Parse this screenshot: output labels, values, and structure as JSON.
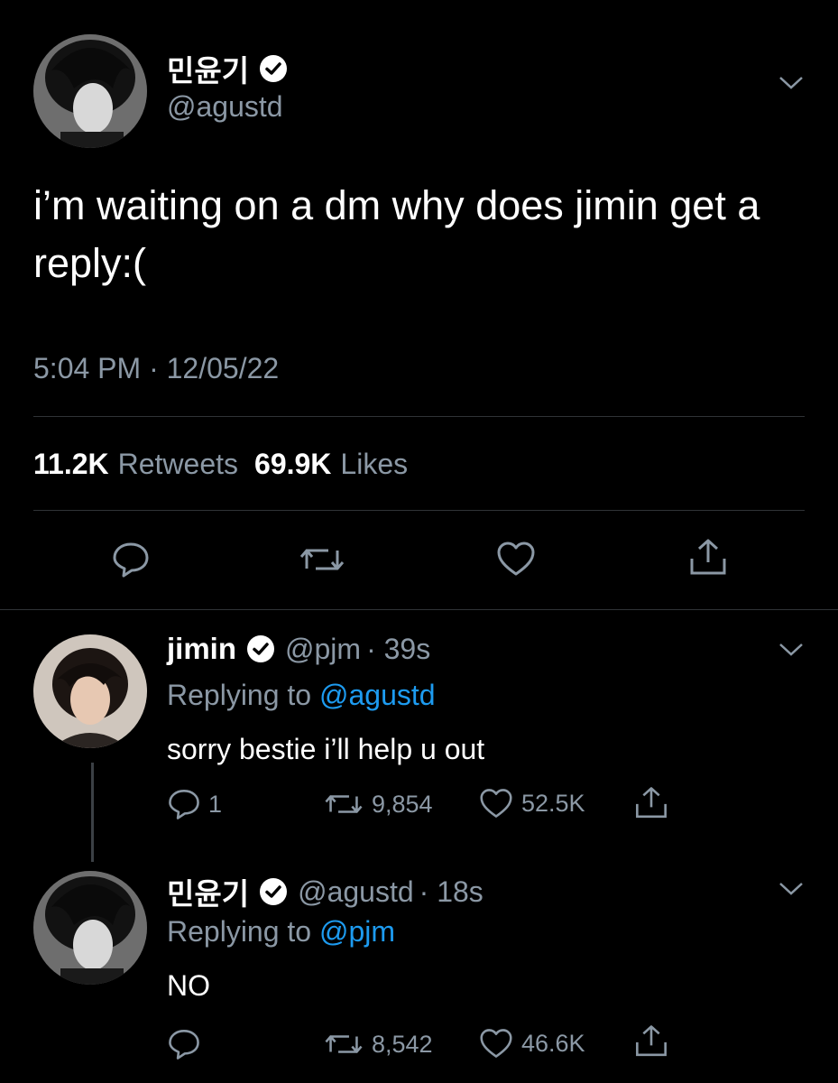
{
  "main_tweet": {
    "display_name": "민윤기",
    "handle": "@agustd",
    "text": "i’m waiting on a dm why does jimin get a reply:(",
    "timestamp": "5:04 PM · 12/05/22",
    "retweets_count": "11.2K",
    "retweets_label": "Retweets",
    "likes_count": "69.9K",
    "likes_label": "Likes"
  },
  "replies": [
    {
      "display_name": "jimin",
      "handle": "@pjm",
      "time": "· 39s",
      "replying_prefix": "Replying to",
      "replying_to": "@agustd",
      "text": "sorry bestie i’ll help u out",
      "reply_count": "1",
      "retweet_count": "9,854",
      "like_count": "52.5K"
    },
    {
      "display_name": "민윤기",
      "handle": "@agustd",
      "time": "· 18s",
      "replying_prefix": "Replying to",
      "replying_to": "@pjm",
      "text": "NO",
      "reply_count": "",
      "retweet_count": "8,542",
      "like_count": "46.6K"
    }
  ],
  "colors": {
    "background": "#000000",
    "muted": "#8b98a5",
    "link": "#1d9bf0",
    "divider": "#2f3336"
  },
  "icons": [
    "verified-badge-icon",
    "chevron-down-icon",
    "reply-icon",
    "retweet-icon",
    "like-icon",
    "share-icon"
  ]
}
